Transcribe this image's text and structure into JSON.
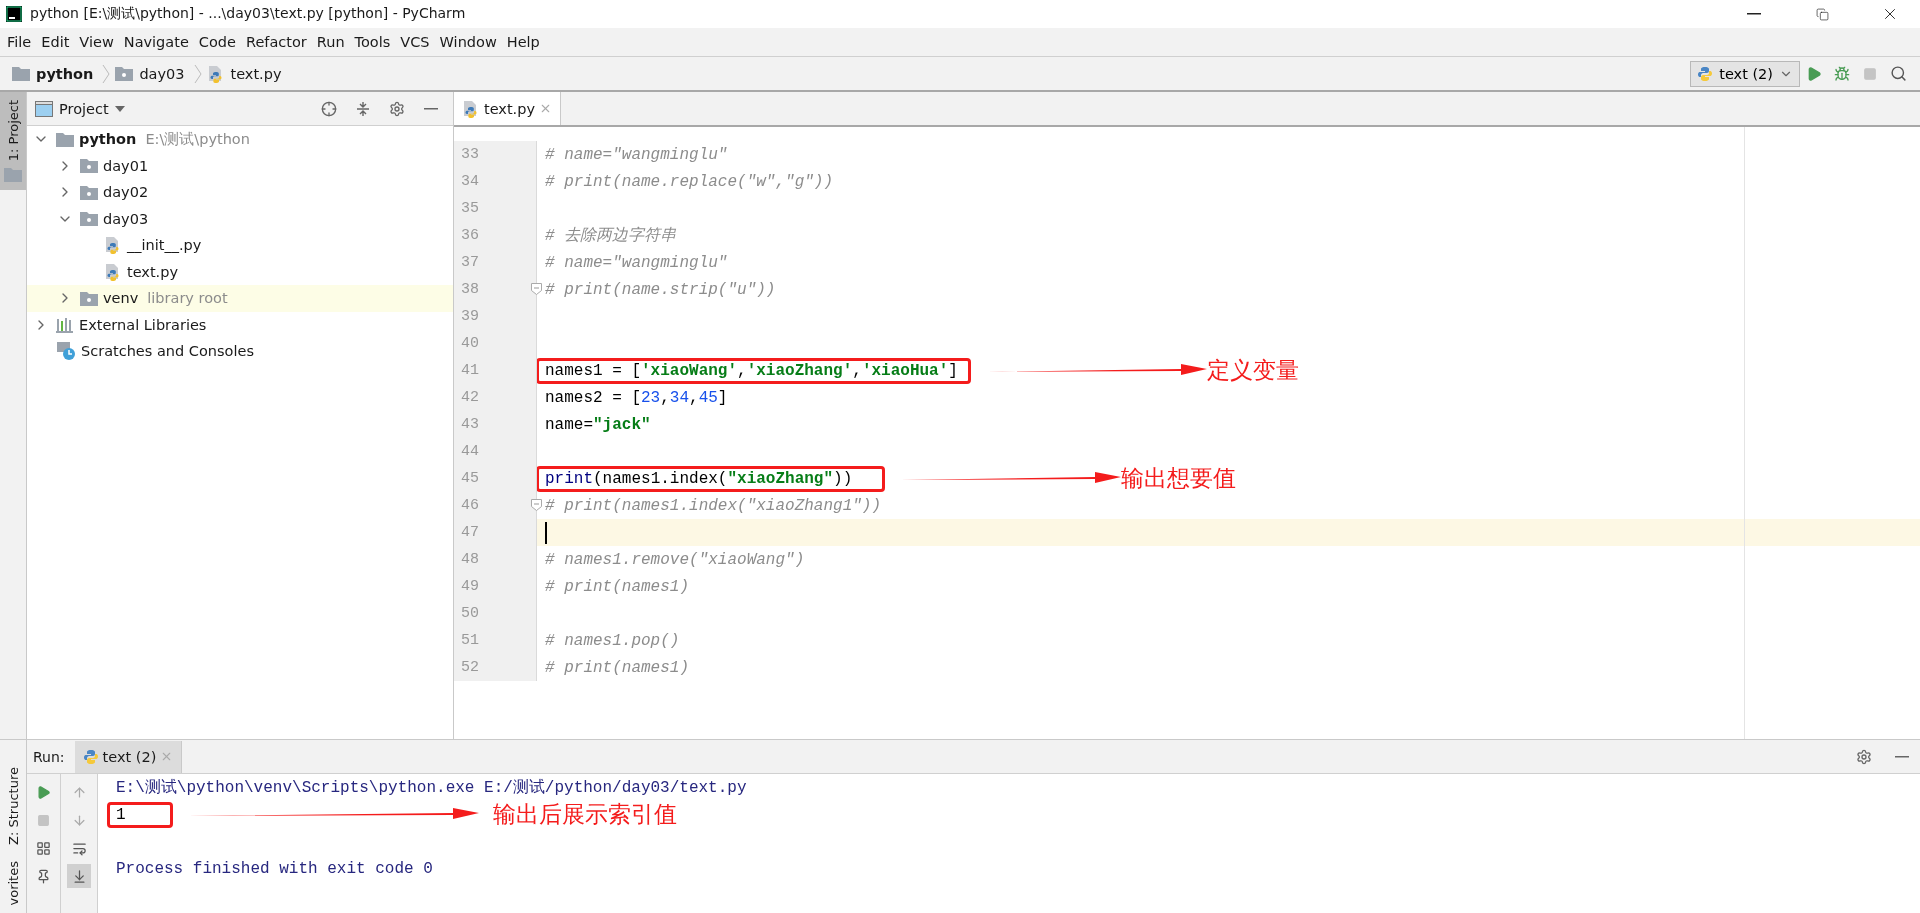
{
  "window": {
    "title": "python [E:\\测试\\python] - ...\\day03\\text.py [python] - PyCharm"
  },
  "menu": [
    "File",
    "Edit",
    "View",
    "Navigate",
    "Code",
    "Refactor",
    "Run",
    "Tools",
    "VCS",
    "Window",
    "Help"
  ],
  "breadcrumbs": [
    {
      "label": "python",
      "kind": "project"
    },
    {
      "label": "day03",
      "kind": "folder"
    },
    {
      "label": "text.py",
      "kind": "file"
    }
  ],
  "run_config": {
    "label": "text (2)"
  },
  "tool_strip": {
    "top": [
      {
        "label": "1: Project",
        "selected": true
      }
    ],
    "bottom": [
      {
        "label": "Z: Structure",
        "selected": false
      },
      {
        "label": "vorites",
        "selected": false
      }
    ]
  },
  "project_panel": {
    "title": "Project",
    "tree": [
      {
        "label": "python",
        "hint": "E:\\测试\\python",
        "kind": "project",
        "expanded": true,
        "highlighted": false,
        "children": [
          {
            "label": "day01",
            "kind": "folder",
            "expanded": false,
            "highlighted": false
          },
          {
            "label": "day02",
            "kind": "folder",
            "expanded": false,
            "highlighted": false
          },
          {
            "label": "day03",
            "kind": "folder",
            "expanded": true,
            "highlighted": false,
            "children": [
              {
                "label": "__init__.py",
                "kind": "file",
                "highlighted": false
              },
              {
                "label": "text.py",
                "kind": "file",
                "highlighted": false
              }
            ]
          },
          {
            "label": "venv",
            "hint": "library root",
            "kind": "folder",
            "expanded": false,
            "highlighted": true
          }
        ]
      },
      {
        "label": "External Libraries",
        "kind": "libraries",
        "expanded": false,
        "highlighted": false
      },
      {
        "label": "Scratches and Consoles",
        "kind": "scratches",
        "highlighted": false
      }
    ]
  },
  "editor": {
    "tabs": [
      {
        "label": "text.py",
        "selected": true
      }
    ],
    "lines": [
      {
        "number": "33",
        "current": false,
        "fold": false,
        "tokens": [
          {
            "kind": "comment",
            "text": "# name=\"wangminglu\""
          }
        ]
      },
      {
        "number": "34",
        "current": false,
        "fold": false,
        "tokens": [
          {
            "kind": "comment",
            "text": "# print(name.replace(\"w\",\"g\"))"
          }
        ]
      },
      {
        "number": "35",
        "current": false,
        "fold": false
      },
      {
        "number": "36",
        "current": false,
        "fold": false,
        "tokens": [
          {
            "kind": "comment",
            "text": "# 去除两边字符串"
          }
        ]
      },
      {
        "number": "37",
        "current": false,
        "fold": false,
        "tokens": [
          {
            "kind": "comment",
            "text": "# name=\"wangminglu\""
          }
        ]
      },
      {
        "number": "38",
        "current": false,
        "fold": true,
        "tokens": [
          {
            "kind": "comment",
            "text": "# print(name.strip(\"u\"))"
          }
        ]
      },
      {
        "number": "39",
        "current": false,
        "fold": false
      },
      {
        "number": "40",
        "current": false,
        "fold": false
      },
      {
        "number": "41",
        "current": false,
        "fold": false,
        "annotation": "定义变量",
        "tokens": [
          {
            "kind": "plain",
            "text": "names1 = ["
          },
          {
            "kind": "string",
            "text": "'xiaoWang'"
          },
          {
            "kind": "plain",
            "text": ","
          },
          {
            "kind": "string",
            "text": "'xiaoZhang'"
          },
          {
            "kind": "plain",
            "text": ","
          },
          {
            "kind": "string",
            "text": "'xiaoHua'"
          },
          {
            "kind": "plain",
            "text": "]"
          }
        ]
      },
      {
        "number": "42",
        "current": false,
        "fold": false,
        "tokens": [
          {
            "kind": "plain",
            "text": "names2 = ["
          },
          {
            "kind": "number",
            "text": "23"
          },
          {
            "kind": "plain",
            "text": ","
          },
          {
            "kind": "number",
            "text": "34"
          },
          {
            "kind": "plain",
            "text": ","
          },
          {
            "kind": "number",
            "text": "45"
          },
          {
            "kind": "plain",
            "text": "]"
          }
        ]
      },
      {
        "number": "43",
        "current": false,
        "fold": false,
        "tokens": [
          {
            "kind": "plain",
            "text": "name="
          },
          {
            "kind": "string",
            "text": "\"jack\""
          }
        ]
      },
      {
        "number": "44",
        "current": false,
        "fold": false
      },
      {
        "number": "45",
        "current": false,
        "fold": false,
        "annotation": "输出想要值",
        "tokens": [
          {
            "kind": "builtin",
            "text": "print"
          },
          {
            "kind": "plain",
            "text": "(names1.index("
          },
          {
            "kind": "string",
            "text": "\"xiaoZhang\""
          },
          {
            "kind": "plain",
            "text": "))"
          }
        ]
      },
      {
        "number": "46",
        "current": false,
        "fold": true,
        "tokens": [
          {
            "kind": "comment",
            "text": "# print(names1.index(\"xiaoZhang1\"))"
          }
        ]
      },
      {
        "number": "47",
        "current": true,
        "fold": false
      },
      {
        "number": "48",
        "current": false,
        "fold": false,
        "tokens": [
          {
            "kind": "comment",
            "text": "# names1.remove(\"xiaoWang\")"
          }
        ]
      },
      {
        "number": "49",
        "current": false,
        "fold": false,
        "tokens": [
          {
            "kind": "comment",
            "text": "# print(names1)"
          }
        ]
      },
      {
        "number": "50",
        "current": false,
        "fold": false
      },
      {
        "number": "51",
        "current": false,
        "fold": false,
        "tokens": [
          {
            "kind": "comment",
            "text": "# names1.pop()"
          }
        ]
      },
      {
        "number": "52",
        "current": false,
        "fold": false,
        "tokens": [
          {
            "kind": "comment",
            "text": "# print(names1)"
          }
        ]
      }
    ]
  },
  "run_panel": {
    "label": "Run:",
    "tabs": [
      {
        "label": "text (2)",
        "selected": true
      }
    ],
    "output": [
      {
        "kind": "command",
        "text": "E:\\测试\\python\\venv\\Scripts\\python.exe E:/测试/python/day03/text.py"
      },
      {
        "kind": "result",
        "text": "1",
        "annotation": "输出后展示索引值"
      },
      {
        "kind": "exit",
        "text": "Process finished with exit code 0"
      }
    ]
  }
}
